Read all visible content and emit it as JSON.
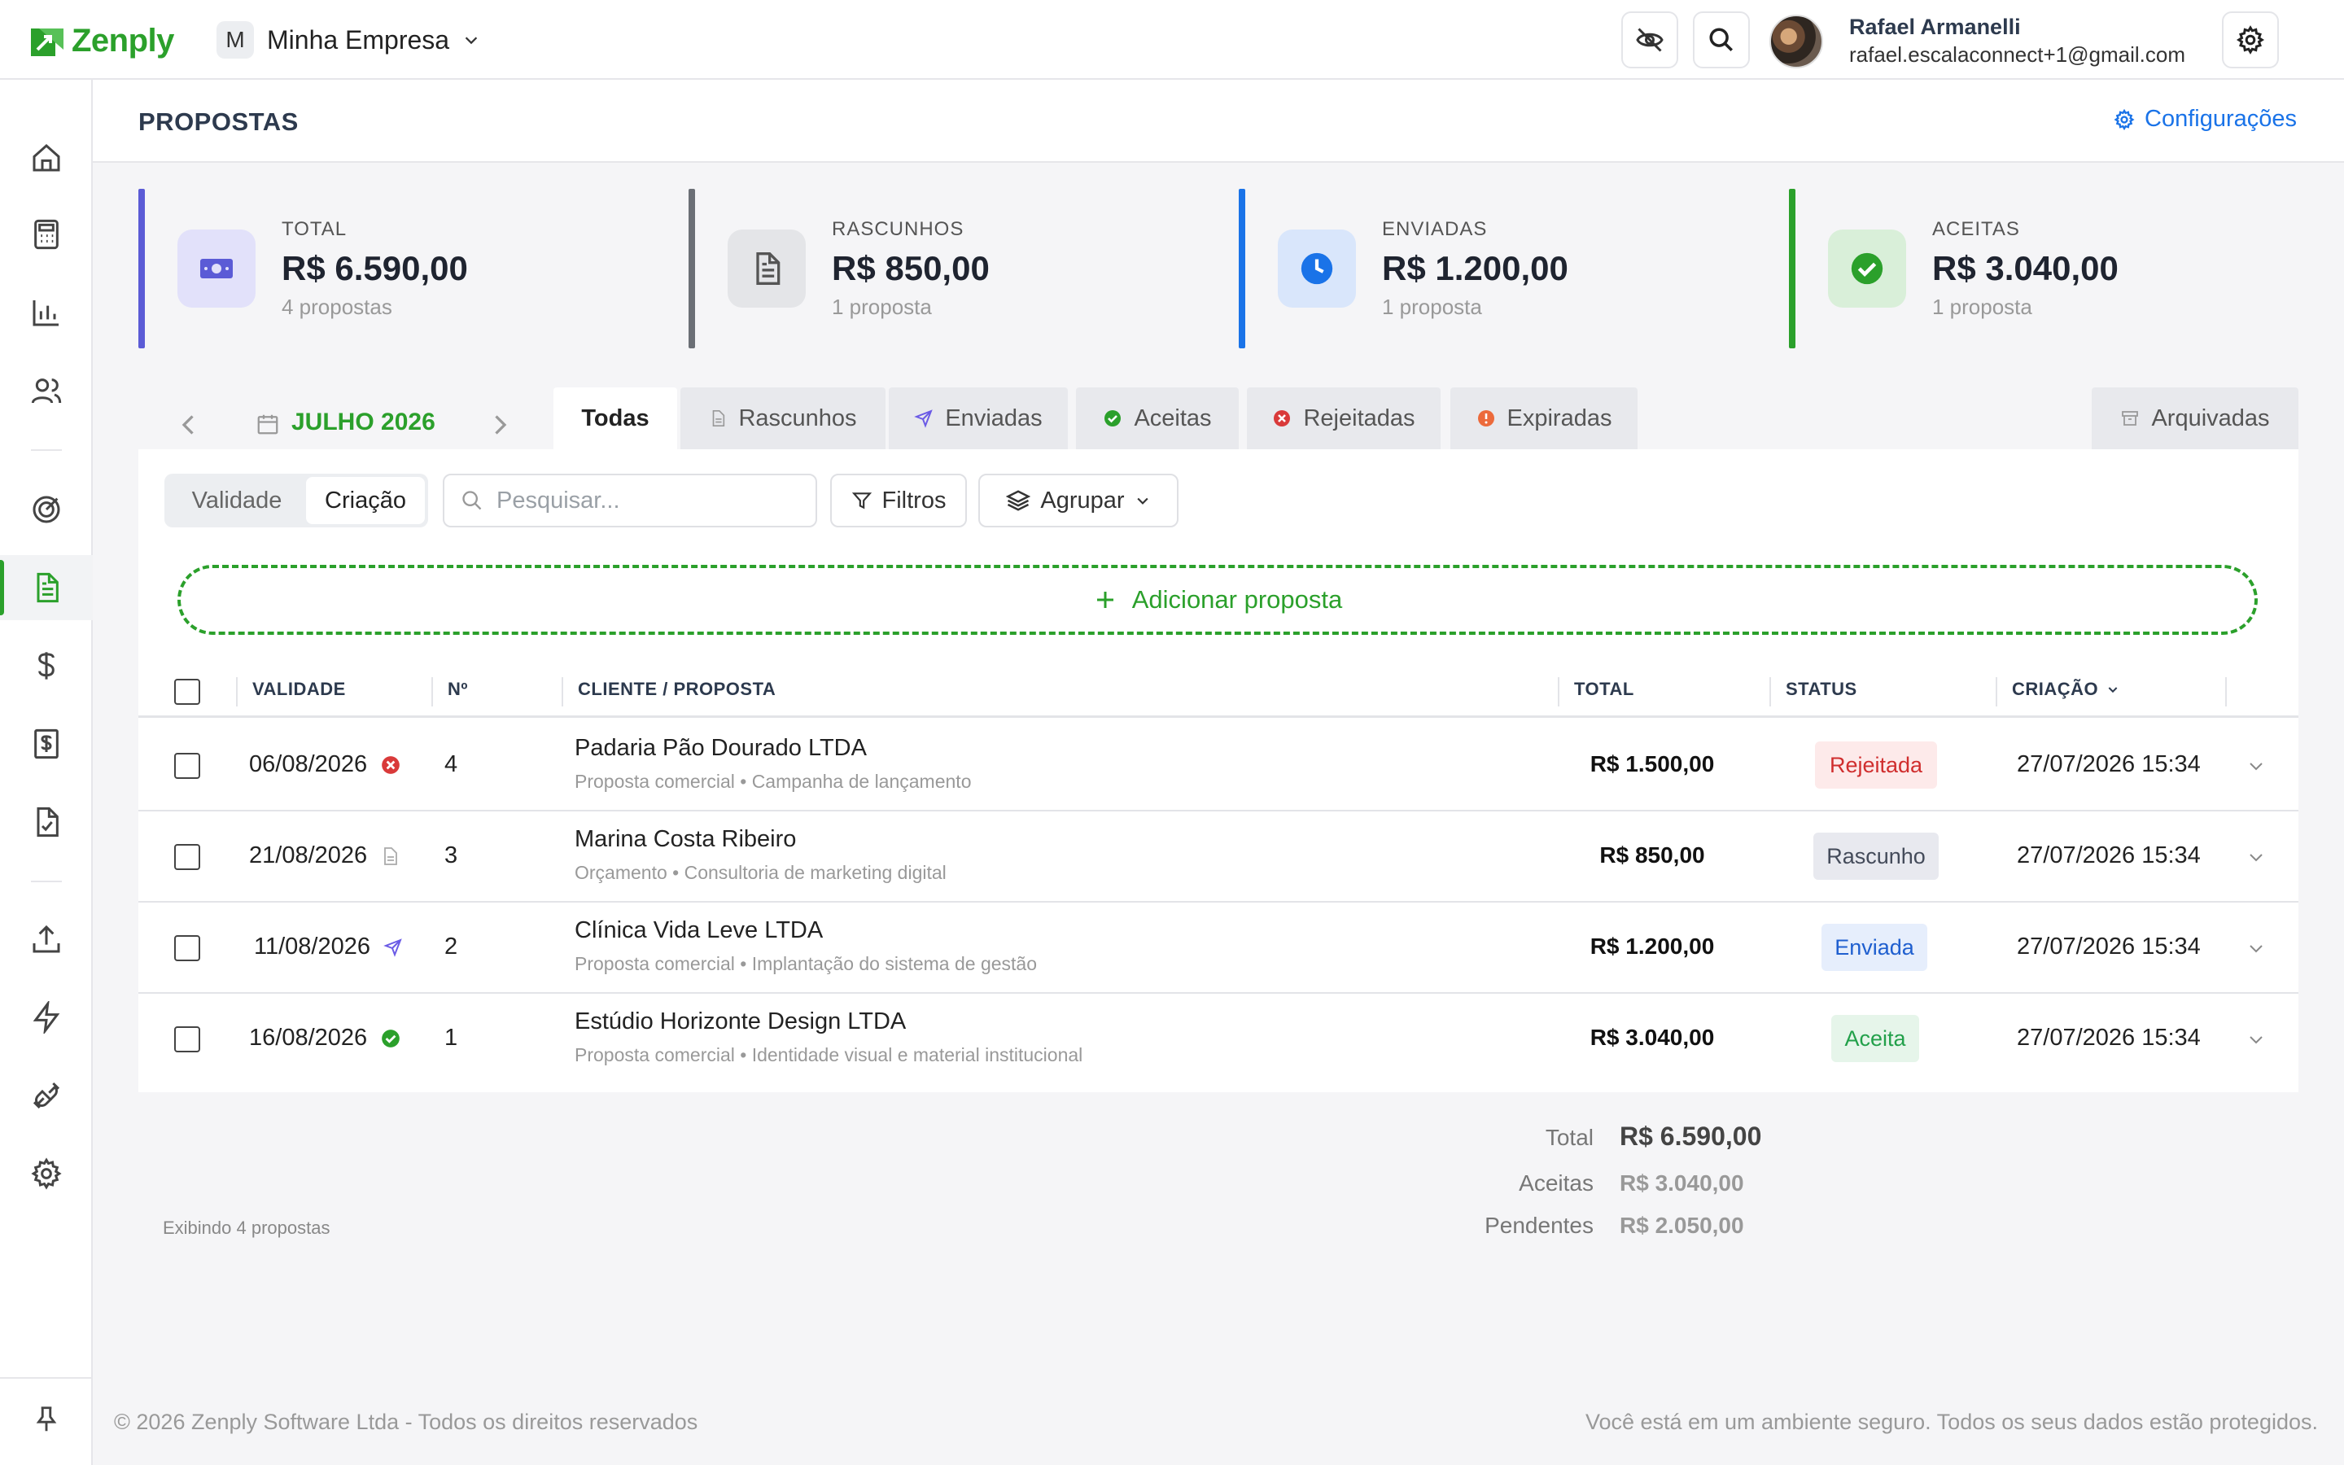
{
  "app": {
    "brand": "Zenply",
    "brand_color": "#2ba02b"
  },
  "header": {
    "company_initial": "M",
    "company_name": "Minha Empresa",
    "user_name": "Rafael Armanelli",
    "user_email": "rafael.escalaconnect+1@gmail.com",
    "icons": [
      "eye-off-icon",
      "search-icon",
      "gear-icon"
    ]
  },
  "sidebar": {
    "items": [
      "home",
      "calculator",
      "bar-chart",
      "users",
      "target",
      "proposals",
      "dollar",
      "receipt",
      "checklist",
      "upload",
      "lightning",
      "plug",
      "settings"
    ],
    "active": "proposals",
    "bottom": "pin"
  },
  "page": {
    "title": "PROPOSTAS",
    "config_label": "Configurações"
  },
  "cards": [
    {
      "label": "TOTAL",
      "value": "R$ 6.590,00",
      "count": "4 propostas",
      "color": "#5b5bd6"
    },
    {
      "label": "RASCUNHOS",
      "value": "R$ 850,00",
      "count": "1 proposta",
      "color": "#6b6f76"
    },
    {
      "label": "ENVIADAS",
      "value": "R$ 1.200,00",
      "count": "1 proposta",
      "color": "#1a73e8"
    },
    {
      "label": "ACEITAS",
      "value": "R$ 3.040,00",
      "count": "1 proposta",
      "color": "#2ba02b"
    }
  ],
  "period": {
    "label": "JULHO 2026"
  },
  "tabs": [
    {
      "label": "Todas",
      "active": true
    },
    {
      "label": "Rascunhos"
    },
    {
      "label": "Enviadas"
    },
    {
      "label": "Aceitas"
    },
    {
      "label": "Rejeitadas"
    },
    {
      "label": "Expiradas"
    },
    {
      "label": "Arquivadas"
    }
  ],
  "toolbar": {
    "segments": [
      "Validade",
      "Criação"
    ],
    "active_segment": "Criação",
    "search_placeholder": "Pesquisar...",
    "filters_label": "Filtros",
    "group_label": "Agrupar",
    "add_label": "Adicionar proposta"
  },
  "table": {
    "columns": [
      "VALIDADE",
      "Nº",
      "CLIENTE / PROPOSTA",
      "TOTAL",
      "STATUS",
      "CRIAÇÃO"
    ],
    "rows": [
      {
        "validity": "06/08/2026",
        "validity_icon": "rejected-icon",
        "number": "4",
        "client": "Padaria Pão Dourado LTDA",
        "desc": "Proposta comercial • Campanha de lançamento",
        "total": "R$ 1.500,00",
        "status": "Rejeitada",
        "created": "27/07/2026 15:34"
      },
      {
        "validity": "21/08/2026",
        "validity_icon": "document-icon",
        "number": "3",
        "client": "Marina Costa Ribeiro",
        "desc": "Orçamento • Consultoria de marketing digital",
        "total": "R$ 850,00",
        "status": "Rascunho",
        "created": "27/07/2026 15:34"
      },
      {
        "validity": "11/08/2026",
        "validity_icon": "send-icon",
        "number": "2",
        "client": "Clínica Vida Leve LTDA",
        "desc": "Proposta comercial • Implantação do sistema de gestão",
        "total": "R$ 1.200,00",
        "status": "Enviada",
        "created": "27/07/2026 15:34"
      },
      {
        "validity": "16/08/2026",
        "validity_icon": "accepted-icon",
        "number": "1",
        "client": "Estúdio Horizonte Design LTDA",
        "desc": "Proposta comercial • Identidade visual e material institucional",
        "total": "R$ 3.040,00",
        "status": "Aceita",
        "created": "27/07/2026 15:34"
      }
    ]
  },
  "totals": {
    "total_label": "Total",
    "total_value": "R$ 6.590,00",
    "accepted_label": "Aceitas",
    "accepted_value": "R$ 3.040,00",
    "pending_label": "Pendentes",
    "pending_value": "R$ 2.050,00",
    "showing": "Exibindo 4 propostas"
  },
  "footer": {
    "left": "© 2026 Zenply Software Ltda - Todos os direitos reservados",
    "right": "Você está em um ambiente seguro. Todos os seus dados estão protegidos."
  }
}
